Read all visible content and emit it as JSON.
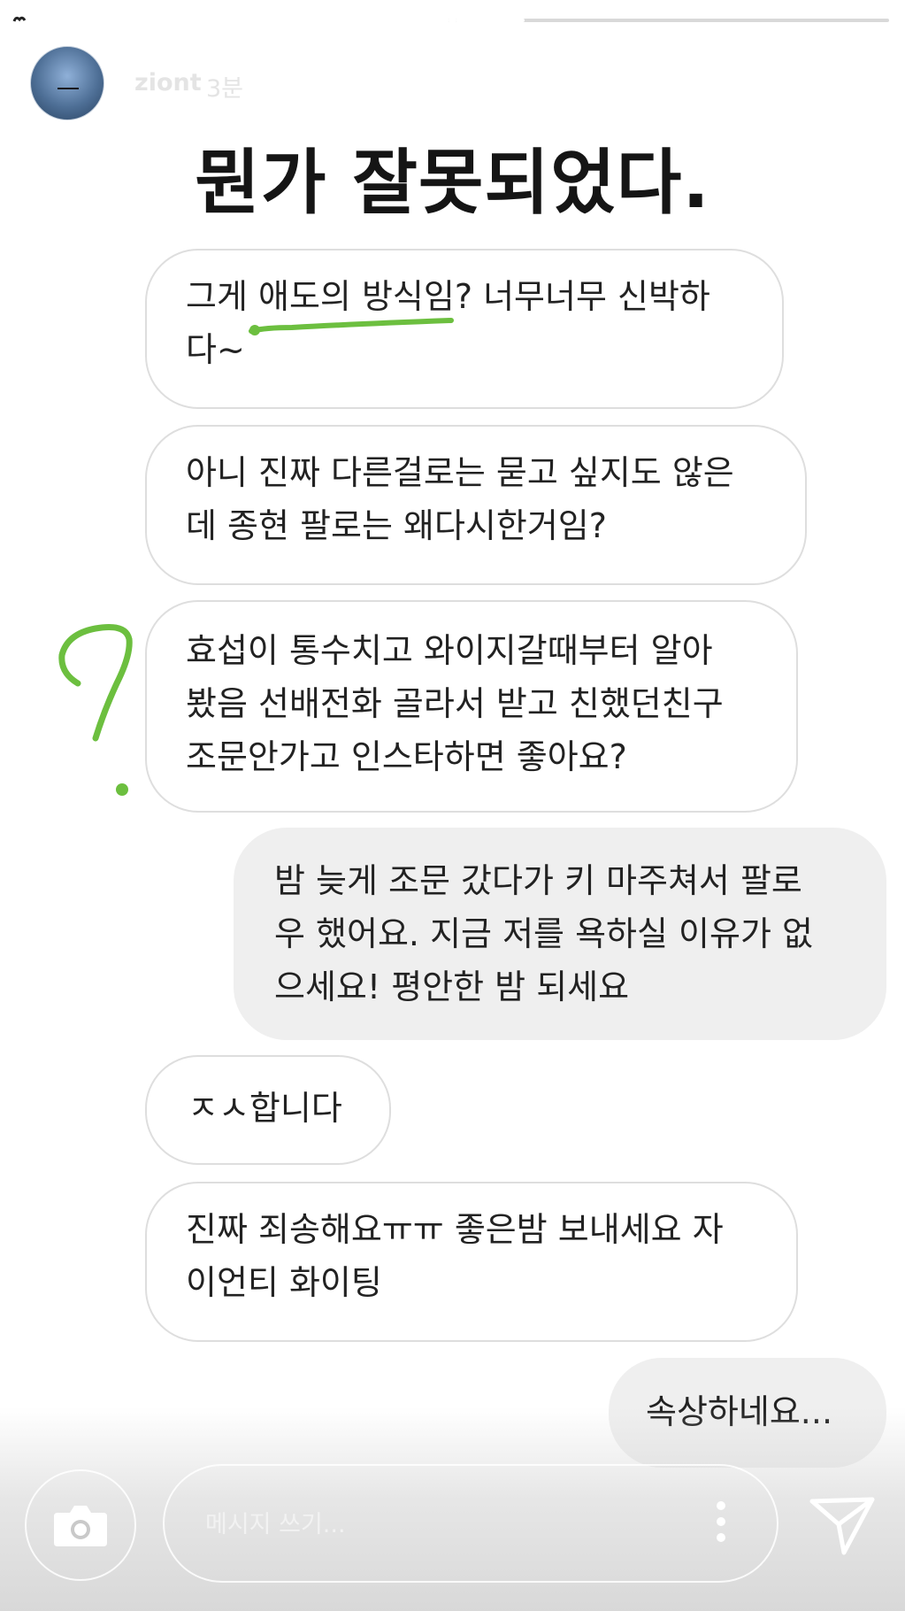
{
  "story": {
    "username": "ziont",
    "time_ago": "3분",
    "headline": "뭔가 잘못되었다."
  },
  "messages": [
    {
      "direction": "incoming",
      "text": "그게 애도의 방식임? 너무너무 신박하\n다~"
    },
    {
      "direction": "incoming",
      "text": "아니 진짜 다른걸로는 묻고 싶지도 않은\n데 종현 팔로는 왜다시한거임?"
    },
    {
      "direction": "incoming",
      "text": "효섭이 통수치고 와이지갈때부터 알아\n봤음 선배전화 골라서 받고 친했던친구\n조문안가고 인스타하면 좋아요?"
    },
    {
      "direction": "outgoing",
      "text": "밤 늦게 조문 갔다가 키 마주쳐서 팔로\n우 했어요. 지금 저를 욕하실 이유가 없\n으세요! 평안한 밤 되세요"
    },
    {
      "direction": "incoming",
      "text": "ㅈㅅ합니다"
    },
    {
      "direction": "incoming",
      "text": "진짜 죄송해요ㅠㅠ 좋은밤 보내세요 자\n이언티 화이팅"
    },
    {
      "direction": "outgoing",
      "text": "속상하네요..."
    }
  ],
  "reply_bar": {
    "placeholder": "메시지 쓰기...",
    "camera_icon": "camera-icon",
    "more_icon": "more-vertical-icon",
    "send_icon": "send-icon"
  },
  "colors": {
    "annotation_green": "#6cbf3f",
    "incoming_bubble": "#ffffff",
    "outgoing_bubble": "#efefef",
    "headline": "#151515"
  }
}
